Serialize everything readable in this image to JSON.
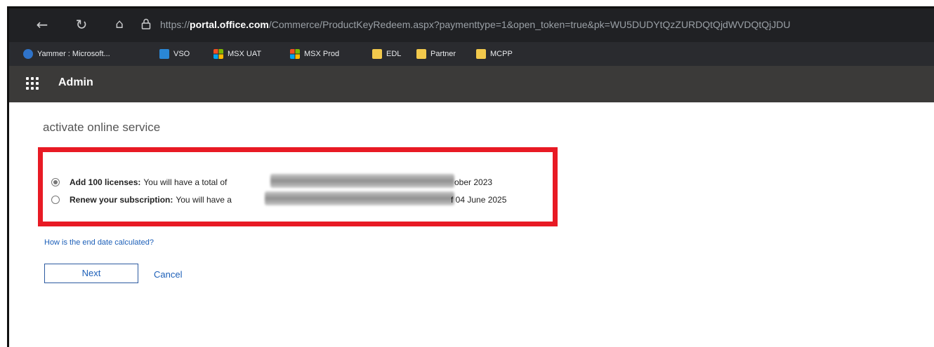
{
  "browser": {
    "url_scheme": "https://",
    "url_host": "portal.office.com",
    "url_path": "/Commerce/ProductKeyRedeem.aspx?paymenttype=1&open_token=true&pk=WU5DUDYtQzZURDQtQjdWVDQtQjJDU",
    "icons": {
      "back": "back-arrow-icon",
      "reload": "reload-icon",
      "home": "home-icon",
      "lock": "lock-icon"
    }
  },
  "bookmarks": [
    {
      "label": "Yammer : Microsoft...",
      "icon": "yammer-icon",
      "color": "#2f73c9"
    },
    {
      "label": "VSO",
      "icon": "vso-icon",
      "color": "#2a87d6"
    },
    {
      "label": "MSX UAT",
      "icon": "windows-logo-icon",
      "color": "#f25022"
    },
    {
      "label": "MSX Prod",
      "icon": "windows-logo-icon",
      "color": "#f25022"
    },
    {
      "label": "EDL",
      "icon": "folder-icon",
      "color": "#f2c94c"
    },
    {
      "label": "Partner",
      "icon": "folder-icon",
      "color": "#f2c94c"
    },
    {
      "label": "MCPP",
      "icon": "folder-icon",
      "color": "#f2c94c"
    }
  ],
  "appbar": {
    "title": "Admin",
    "launcher_icon": "app-launcher-icon"
  },
  "main": {
    "heading": "activate online service",
    "options": [
      {
        "label": "Add 100 licenses:",
        "text": "You will have a total of",
        "tail": "ober 2023",
        "selected": true
      },
      {
        "label": "Renew your subscription:",
        "text": "You will have a",
        "tail": "f 04 June 2025",
        "selected": false
      }
    ],
    "help_link": "How is the end date calculated?",
    "next_label": "Next",
    "cancel_label": "Cancel"
  },
  "colors": {
    "highlight": "#e81a24",
    "link": "#1c5fb8",
    "appbar": "#3b3a39"
  }
}
